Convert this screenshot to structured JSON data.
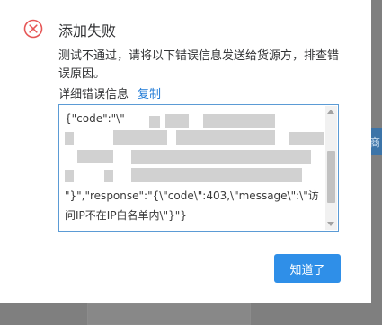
{
  "dialog": {
    "title": "添加失败",
    "message": "测试不通过，请将以下错误信息发送给货源方，排查错误原因。",
    "detail_label": "详细错误信息",
    "copy_label": "复制",
    "error_text_lines": [
      "{\"code\":\"\\\"",
      "",
      "",
      "",
      "\"}\",\"response\":\"{\\\"code\\\":403,\\\"message\\\":\\\"访",
      "问IP不在IP白名单内\\\"}\"}"
    ],
    "ok_label": "知道了",
    "icon": "error-circle-x-icon",
    "icon_color": "#e65656",
    "button_color": "#2f8fe8",
    "link_color": "#1f7ad6"
  },
  "background": {
    "right_button_label": "商"
  }
}
